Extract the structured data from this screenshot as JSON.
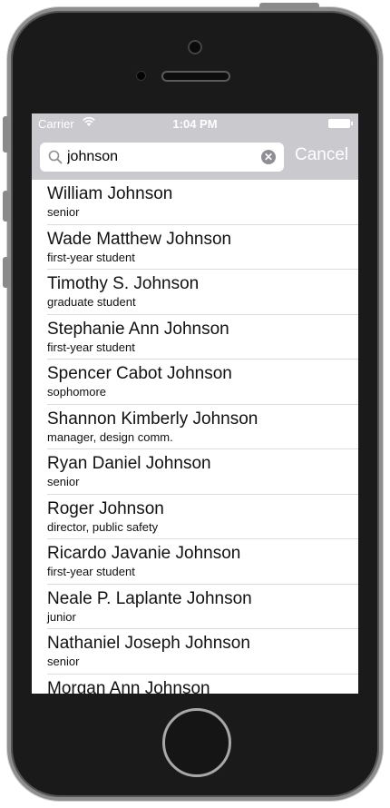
{
  "status_bar": {
    "carrier": "Carrier",
    "time": "1:04 PM"
  },
  "search": {
    "query": "johnson",
    "cancel_label": "Cancel"
  },
  "results": [
    {
      "name": "William Johnson",
      "role": "senior"
    },
    {
      "name": "Wade Matthew Johnson",
      "role": "first-year student"
    },
    {
      "name": "Timothy S. Johnson",
      "role": "graduate student"
    },
    {
      "name": "Stephanie Ann Johnson",
      "role": "first-year student"
    },
    {
      "name": "Spencer Cabot Johnson",
      "role": "sophomore"
    },
    {
      "name": "Shannon Kimberly Johnson",
      "role": "manager, design comm."
    },
    {
      "name": "Ryan Daniel Johnson",
      "role": "senior"
    },
    {
      "name": "Roger Johnson",
      "role": "director, public safety"
    },
    {
      "name": "Ricardo Javanie Johnson",
      "role": "first-year student"
    },
    {
      "name": "Neale P. Laplante Johnson",
      "role": "junior"
    },
    {
      "name": "Nathaniel Joseph Johnson",
      "role": "senior"
    },
    {
      "name": "Morgan Ann Johnson",
      "role": ""
    }
  ],
  "icons": {
    "wifi": "wifi-icon",
    "battery": "battery-icon",
    "search": "search-icon",
    "clear": "clear-icon"
  },
  "colors": {
    "header_background": "#c9c9ce",
    "phone_body": "#1a1a1a"
  }
}
